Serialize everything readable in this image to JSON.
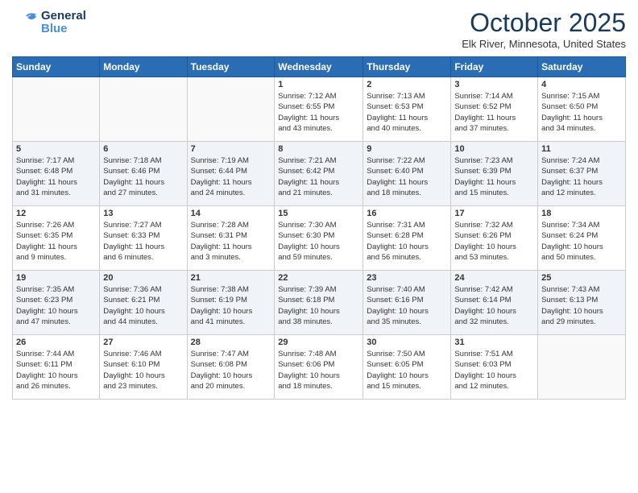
{
  "logo": {
    "line1": "General",
    "line2": "Blue"
  },
  "title": "October 2025",
  "location": "Elk River, Minnesota, United States",
  "weekdays": [
    "Sunday",
    "Monday",
    "Tuesday",
    "Wednesday",
    "Thursday",
    "Friday",
    "Saturday"
  ],
  "weeks": [
    [
      {
        "day": "",
        "info": ""
      },
      {
        "day": "",
        "info": ""
      },
      {
        "day": "",
        "info": ""
      },
      {
        "day": "1",
        "info": "Sunrise: 7:12 AM\nSunset: 6:55 PM\nDaylight: 11 hours\nand 43 minutes."
      },
      {
        "day": "2",
        "info": "Sunrise: 7:13 AM\nSunset: 6:53 PM\nDaylight: 11 hours\nand 40 minutes."
      },
      {
        "day": "3",
        "info": "Sunrise: 7:14 AM\nSunset: 6:52 PM\nDaylight: 11 hours\nand 37 minutes."
      },
      {
        "day": "4",
        "info": "Sunrise: 7:15 AM\nSunset: 6:50 PM\nDaylight: 11 hours\nand 34 minutes."
      }
    ],
    [
      {
        "day": "5",
        "info": "Sunrise: 7:17 AM\nSunset: 6:48 PM\nDaylight: 11 hours\nand 31 minutes."
      },
      {
        "day": "6",
        "info": "Sunrise: 7:18 AM\nSunset: 6:46 PM\nDaylight: 11 hours\nand 27 minutes."
      },
      {
        "day": "7",
        "info": "Sunrise: 7:19 AM\nSunset: 6:44 PM\nDaylight: 11 hours\nand 24 minutes."
      },
      {
        "day": "8",
        "info": "Sunrise: 7:21 AM\nSunset: 6:42 PM\nDaylight: 11 hours\nand 21 minutes."
      },
      {
        "day": "9",
        "info": "Sunrise: 7:22 AM\nSunset: 6:40 PM\nDaylight: 11 hours\nand 18 minutes."
      },
      {
        "day": "10",
        "info": "Sunrise: 7:23 AM\nSunset: 6:39 PM\nDaylight: 11 hours\nand 15 minutes."
      },
      {
        "day": "11",
        "info": "Sunrise: 7:24 AM\nSunset: 6:37 PM\nDaylight: 11 hours\nand 12 minutes."
      }
    ],
    [
      {
        "day": "12",
        "info": "Sunrise: 7:26 AM\nSunset: 6:35 PM\nDaylight: 11 hours\nand 9 minutes."
      },
      {
        "day": "13",
        "info": "Sunrise: 7:27 AM\nSunset: 6:33 PM\nDaylight: 11 hours\nand 6 minutes."
      },
      {
        "day": "14",
        "info": "Sunrise: 7:28 AM\nSunset: 6:31 PM\nDaylight: 11 hours\nand 3 minutes."
      },
      {
        "day": "15",
        "info": "Sunrise: 7:30 AM\nSunset: 6:30 PM\nDaylight: 10 hours\nand 59 minutes."
      },
      {
        "day": "16",
        "info": "Sunrise: 7:31 AM\nSunset: 6:28 PM\nDaylight: 10 hours\nand 56 minutes."
      },
      {
        "day": "17",
        "info": "Sunrise: 7:32 AM\nSunset: 6:26 PM\nDaylight: 10 hours\nand 53 minutes."
      },
      {
        "day": "18",
        "info": "Sunrise: 7:34 AM\nSunset: 6:24 PM\nDaylight: 10 hours\nand 50 minutes."
      }
    ],
    [
      {
        "day": "19",
        "info": "Sunrise: 7:35 AM\nSunset: 6:23 PM\nDaylight: 10 hours\nand 47 minutes."
      },
      {
        "day": "20",
        "info": "Sunrise: 7:36 AM\nSunset: 6:21 PM\nDaylight: 10 hours\nand 44 minutes."
      },
      {
        "day": "21",
        "info": "Sunrise: 7:38 AM\nSunset: 6:19 PM\nDaylight: 10 hours\nand 41 minutes."
      },
      {
        "day": "22",
        "info": "Sunrise: 7:39 AM\nSunset: 6:18 PM\nDaylight: 10 hours\nand 38 minutes."
      },
      {
        "day": "23",
        "info": "Sunrise: 7:40 AM\nSunset: 6:16 PM\nDaylight: 10 hours\nand 35 minutes."
      },
      {
        "day": "24",
        "info": "Sunrise: 7:42 AM\nSunset: 6:14 PM\nDaylight: 10 hours\nand 32 minutes."
      },
      {
        "day": "25",
        "info": "Sunrise: 7:43 AM\nSunset: 6:13 PM\nDaylight: 10 hours\nand 29 minutes."
      }
    ],
    [
      {
        "day": "26",
        "info": "Sunrise: 7:44 AM\nSunset: 6:11 PM\nDaylight: 10 hours\nand 26 minutes."
      },
      {
        "day": "27",
        "info": "Sunrise: 7:46 AM\nSunset: 6:10 PM\nDaylight: 10 hours\nand 23 minutes."
      },
      {
        "day": "28",
        "info": "Sunrise: 7:47 AM\nSunset: 6:08 PM\nDaylight: 10 hours\nand 20 minutes."
      },
      {
        "day": "29",
        "info": "Sunrise: 7:48 AM\nSunset: 6:06 PM\nDaylight: 10 hours\nand 18 minutes."
      },
      {
        "day": "30",
        "info": "Sunrise: 7:50 AM\nSunset: 6:05 PM\nDaylight: 10 hours\nand 15 minutes."
      },
      {
        "day": "31",
        "info": "Sunrise: 7:51 AM\nSunset: 6:03 PM\nDaylight: 10 hours\nand 12 minutes."
      },
      {
        "day": "",
        "info": ""
      }
    ]
  ],
  "colors": {
    "header_bg": "#2a6db5",
    "title_color": "#1a3a5c"
  }
}
